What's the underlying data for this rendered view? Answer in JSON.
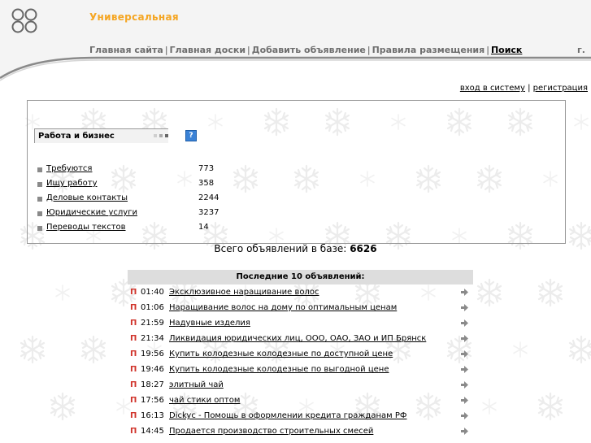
{
  "site": {
    "title": "Универсальная"
  },
  "nav": {
    "items": [
      "Главная сайта",
      "Главная доски",
      "Добавить объявление",
      "Правила размещения",
      "Поиск"
    ],
    "separator": "|",
    "right_text": "г."
  },
  "auth": {
    "login": "вход в систему",
    "separator": "|",
    "register": "регистрация"
  },
  "category": {
    "title": "Работа и бизнес",
    "help_label": "?",
    "rows": [
      {
        "name": "Требуются",
        "count": "773"
      },
      {
        "name": "Ищу работу",
        "count": "358"
      },
      {
        "name": "Деловые контакты",
        "count": "2244"
      },
      {
        "name": "Юридические услуги",
        "count": "3237"
      },
      {
        "name": "Переводы текстов",
        "count": "14"
      }
    ]
  },
  "totals": {
    "label": "Всего объявлений в базе:",
    "value": "6626"
  },
  "recent": {
    "heading": "Последние 10 объявлений:",
    "marker": "П",
    "items": [
      {
        "time": "01:40",
        "title": "Эксклюзивное наращивание волос"
      },
      {
        "time": "01:06",
        "title": "Наращивание волос на дому по оптимальным ценам"
      },
      {
        "time": "21:59",
        "title": "Надувные изделия"
      },
      {
        "time": "21:34",
        "title": "Ликвидация юридических лиц, ООО, ОАО, ЗАО и ИП Брянск"
      },
      {
        "time": "19:56",
        "title": "Купить колодезные колодезные по доступной цене"
      },
      {
        "time": "19:46",
        "title": "Купить колодезные колодезные по выгодной цене"
      },
      {
        "time": "18:27",
        "title": "элитный чай"
      },
      {
        "time": "17:56",
        "title": "чай стики оптом"
      },
      {
        "time": "16:13",
        "title": "Dickyc - Помощь в оформлении кредита гражданам РФ"
      },
      {
        "time": "14:45",
        "title": "Продается производство строительных смесей"
      }
    ]
  },
  "colors": {
    "title_orange": "#f5a623",
    "nav_gray": "#6e6e6e",
    "marker_red": "#d0332a",
    "header_band": "#dddddd",
    "flake_gray": "#ededed"
  },
  "icons": {
    "logo": "four-rings-logo",
    "arrow": "right-arrow-icon",
    "help": "help-icon",
    "bullet": "square-bullet"
  }
}
